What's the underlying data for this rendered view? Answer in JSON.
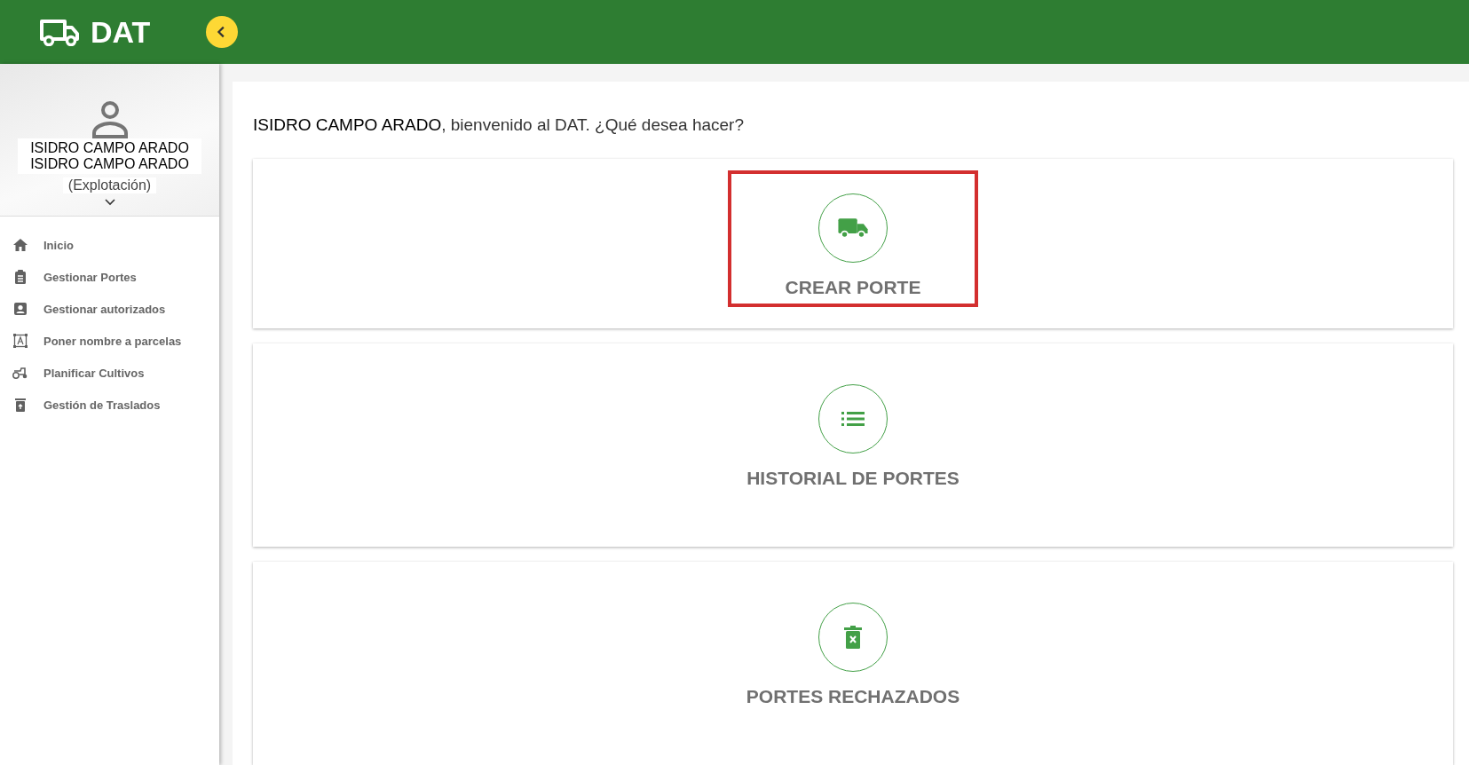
{
  "header": {
    "app_title": "DAT"
  },
  "user": {
    "name_lines": [
      "ISIDRO CAMPO ARADO",
      "ISIDRO CAMPO ARADO"
    ],
    "role": "(Explotación)"
  },
  "sidebar": {
    "items": [
      {
        "label": "Inicio",
        "kind": "home"
      },
      {
        "label": "Gestionar Portes",
        "kind": "clipboard"
      },
      {
        "label": "Gestionar autorizados",
        "kind": "person"
      },
      {
        "label": "Poner nombre a parcelas",
        "kind": "text"
      },
      {
        "label": "Planificar Cultivos",
        "kind": "tractor"
      },
      {
        "label": "Gestión de Traslados",
        "kind": "bin"
      }
    ]
  },
  "welcome": {
    "name": "ISIDRO CAMPO ARADO",
    "text": ", bienvenido al DAT. ¿Qué desea hacer?"
  },
  "actions": [
    {
      "label": "CREAR PORTE",
      "kind": "truck",
      "highlighted": true
    },
    {
      "label": "HISTORIAL DE PORTES",
      "kind": "list",
      "highlighted": false
    },
    {
      "label": "PORTES RECHAZADOS",
      "kind": "bin",
      "highlighted": false
    }
  ]
}
